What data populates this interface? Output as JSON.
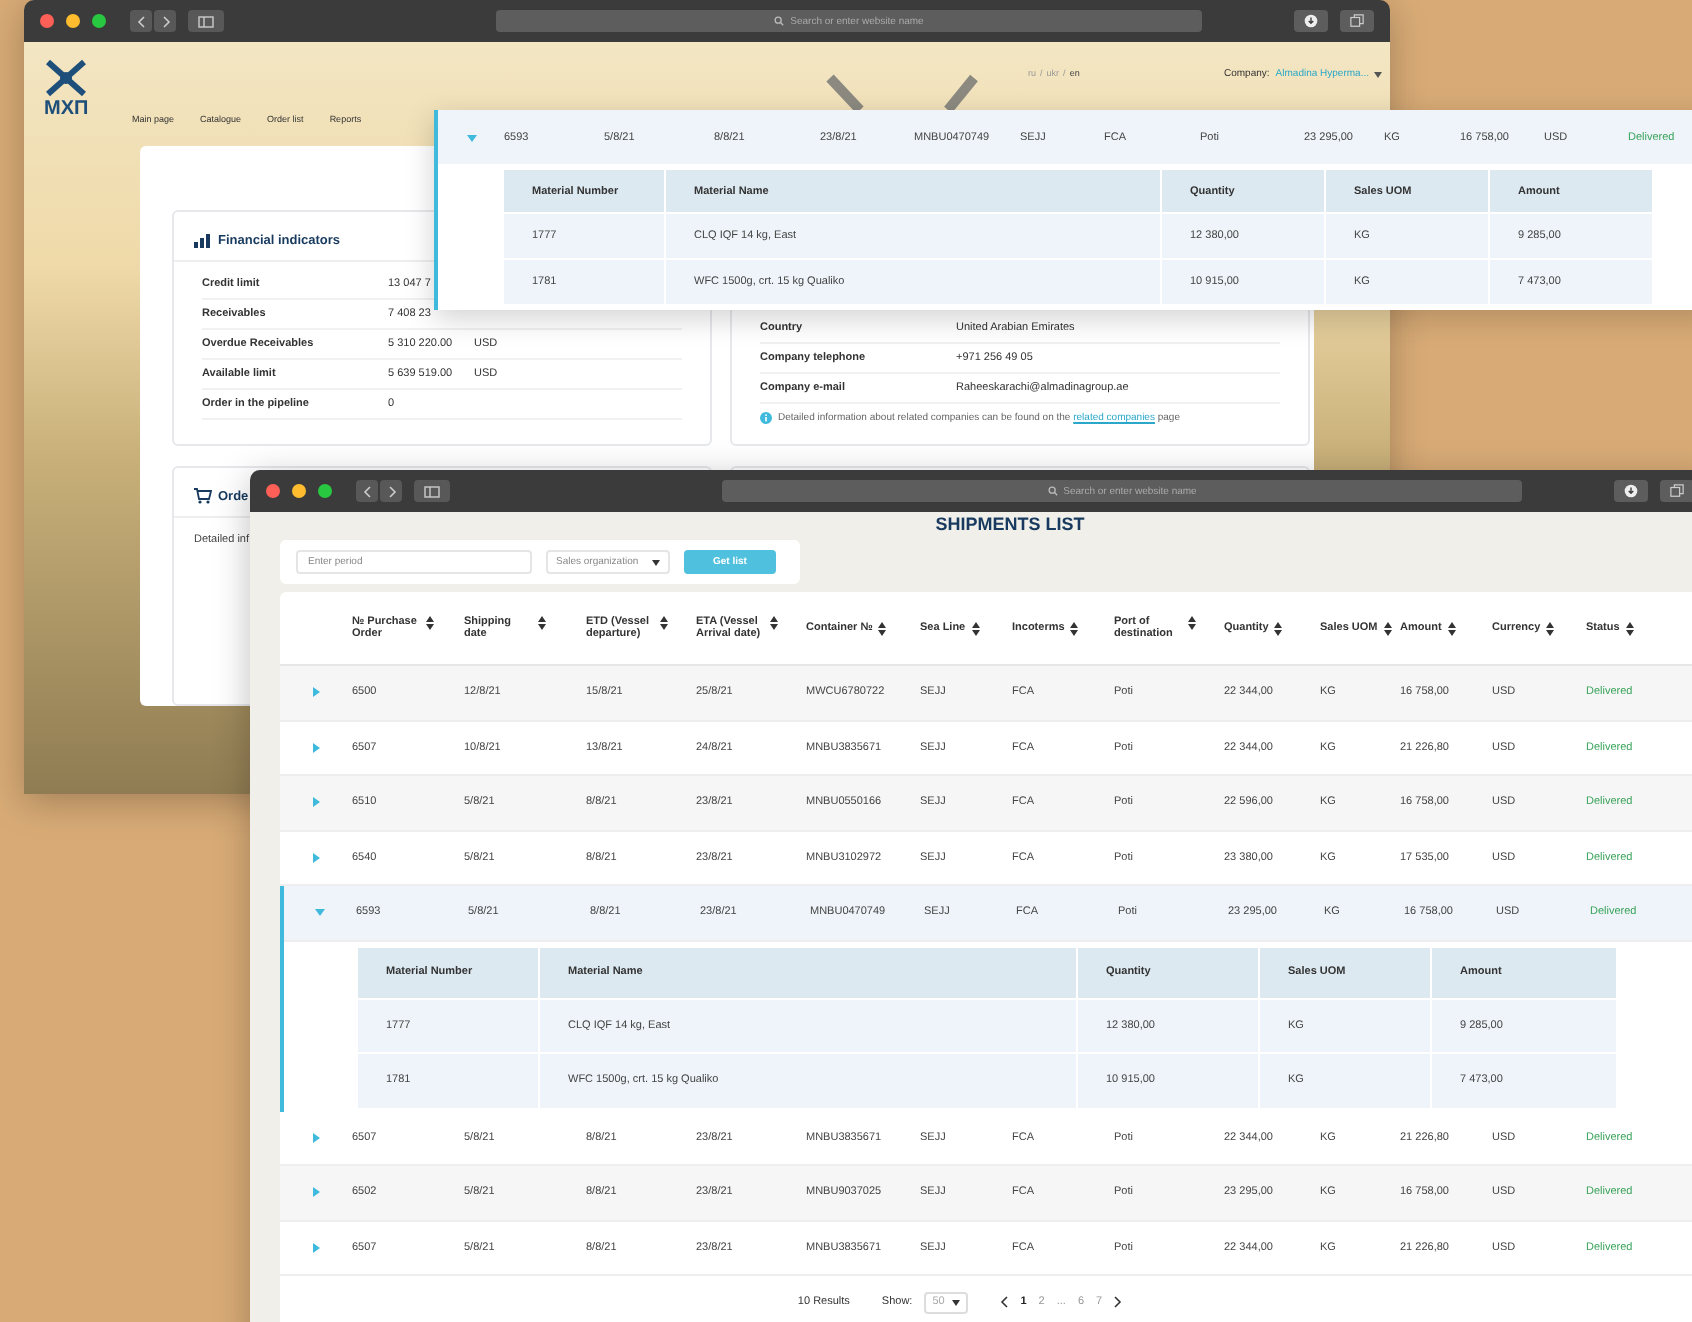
{
  "back_window": {
    "search_placeholder": "Search or enter website name",
    "logo": "МХП",
    "nav": [
      "Main page",
      "Catalogue",
      "Order list",
      "Reports"
    ],
    "languages": [
      {
        "label": "ru",
        "selected": false
      },
      {
        "label": "ukr",
        "selected": false
      },
      {
        "label": "en",
        "selected": true
      }
    ],
    "language_separator": "/",
    "company_label": "Company:",
    "company_value": "Almadina Hyperma...",
    "financial": {
      "title": "Financial indicators",
      "rows": [
        {
          "label": "Credit limit",
          "value": "13 047 7",
          "currency": ""
        },
        {
          "label": "Receivables",
          "value": "7 408 23",
          "currency": ""
        },
        {
          "label": "Overdue Receivables",
          "value": "5 310 220.00",
          "currency": "USD"
        },
        {
          "label": "Available limit",
          "value": "5 639 519.00",
          "currency": "USD"
        },
        {
          "label": "Order in the pipeline",
          "value": "0",
          "currency": ""
        }
      ]
    },
    "company_info": {
      "rows": [
        {
          "label": "Country",
          "value": "United Arabian Emirates"
        },
        {
          "label": "Company telephone",
          "value": "+971 256 49 05"
        },
        {
          "label": "Company e-mail",
          "value": "Raheeskarachi@almadinagroup.ae"
        }
      ],
      "note_before": "Detailed information about related companies can be found on the",
      "note_link": "related companies",
      "note_after": "page"
    },
    "orders_card": {
      "title": "Orde",
      "text": "Detailed inf"
    }
  },
  "detail_popup": {
    "row": {
      "expanded": true,
      "cells": [
        "6593",
        "5/8/21",
        "8/8/21",
        "23/8/21",
        "MNBU0470749",
        "SEJJ",
        "FCA",
        "Poti",
        "23 295,00",
        "KG",
        "16 758,00",
        "USD",
        "Delivered"
      ]
    },
    "materials": {
      "columns": [
        "Material Number",
        "Material Name",
        "Quantity",
        "Sales UOM",
        "Amount"
      ],
      "rows": [
        [
          "1777",
          "CLQ IQF 14 kg, East",
          "12 380,00",
          "KG",
          "9 285,00"
        ],
        [
          "1781",
          "WFC 1500g, crt. 15 kg Qualiko",
          "10 915,00",
          "KG",
          "7 473,00"
        ]
      ]
    }
  },
  "front_window": {
    "search_placeholder": "Search or enter website name",
    "title": "SHIPMENTS LIST",
    "filters": {
      "period_placeholder": "Enter period",
      "organization": "Sales organization",
      "button": "Get list"
    },
    "table": {
      "columns": [
        "№ Purchase Order",
        "Shipping date",
        "ETD (Vessel departure)",
        "ETA (Vessel Arrival date)",
        "Container №",
        "Sea Line",
        "Incoterms",
        "Port of destination",
        "Quantity",
        "Sales UOM",
        "Amount",
        "Currency",
        "Status"
      ],
      "rows": [
        {
          "expanded": false,
          "cells": [
            "6500",
            "12/8/21",
            "15/8/21",
            "25/8/21",
            "MWCU6780722",
            "SEJJ",
            "FCA",
            "Poti",
            "22 344,00",
            "KG",
            "16 758,00",
            "USD",
            "Delivered"
          ]
        },
        {
          "expanded": false,
          "cells": [
            "6507",
            "10/8/21",
            "13/8/21",
            "24/8/21",
            "MNBU3835671",
            "SEJJ",
            "FCA",
            "Poti",
            "22 344,00",
            "KG",
            "21 226,80",
            "USD",
            "Delivered"
          ]
        },
        {
          "expanded": false,
          "cells": [
            "6510",
            "5/8/21",
            "8/8/21",
            "23/8/21",
            "MNBU0550166",
            "SEJJ",
            "FCA",
            "Poti",
            "22 596,00",
            "KG",
            "16 758,00",
            "USD",
            "Delivered"
          ]
        },
        {
          "expanded": false,
          "cells": [
            "6540",
            "5/8/21",
            "8/8/21",
            "23/8/21",
            "MNBU3102972",
            "SEJJ",
            "FCA",
            "Poti",
            "23 380,00",
            "KG",
            "17 535,00",
            "USD",
            "Delivered"
          ]
        },
        {
          "expanded": true,
          "cells": [
            "6593",
            "5/8/21",
            "8/8/21",
            "23/8/21",
            "MNBU0470749",
            "SEJJ",
            "FCA",
            "Poti",
            "23 295,00",
            "KG",
            "16 758,00",
            "USD",
            "Delivered"
          ],
          "materials": {
            "columns": [
              "Material Number",
              "Material Name",
              "Quantity",
              "Sales UOM",
              "Amount"
            ],
            "rows": [
              [
                "1777",
                "CLQ IQF 14 kg, East",
                "12 380,00",
                "KG",
                "9 285,00"
              ],
              [
                "1781",
                "WFC 1500g, crt. 15 kg Qualiko",
                "10 915,00",
                "KG",
                "7 473,00"
              ]
            ]
          }
        },
        {
          "expanded": false,
          "cells": [
            "6507",
            "5/8/21",
            "8/8/21",
            "23/8/21",
            "MNBU3835671",
            "SEJJ",
            "FCA",
            "Poti",
            "22 344,00",
            "KG",
            "21 226,80",
            "USD",
            "Delivered"
          ]
        },
        {
          "expanded": false,
          "cells": [
            "6502",
            "5/8/21",
            "8/8/21",
            "23/8/21",
            "MNBU9037025",
            "SEJJ",
            "FCA",
            "Poti",
            "23 295,00",
            "KG",
            "16 758,00",
            "USD",
            "Delivered"
          ]
        },
        {
          "expanded": false,
          "cells": [
            "6507",
            "5/8/21",
            "8/8/21",
            "23/8/21",
            "MNBU3835671",
            "SEJJ",
            "FCA",
            "Poti",
            "22 344,00",
            "KG",
            "21 226,80",
            "USD",
            "Delivered"
          ]
        }
      ]
    },
    "pagination": {
      "results": "10 Results",
      "show_label": "Show:",
      "show_value": "50",
      "pages": [
        {
          "label": "1",
          "selected": true
        },
        {
          "label": "2",
          "selected": false
        },
        {
          "label": "...",
          "selected": false
        },
        {
          "label": "6",
          "selected": false
        },
        {
          "label": "7",
          "selected": false
        }
      ]
    }
  }
}
